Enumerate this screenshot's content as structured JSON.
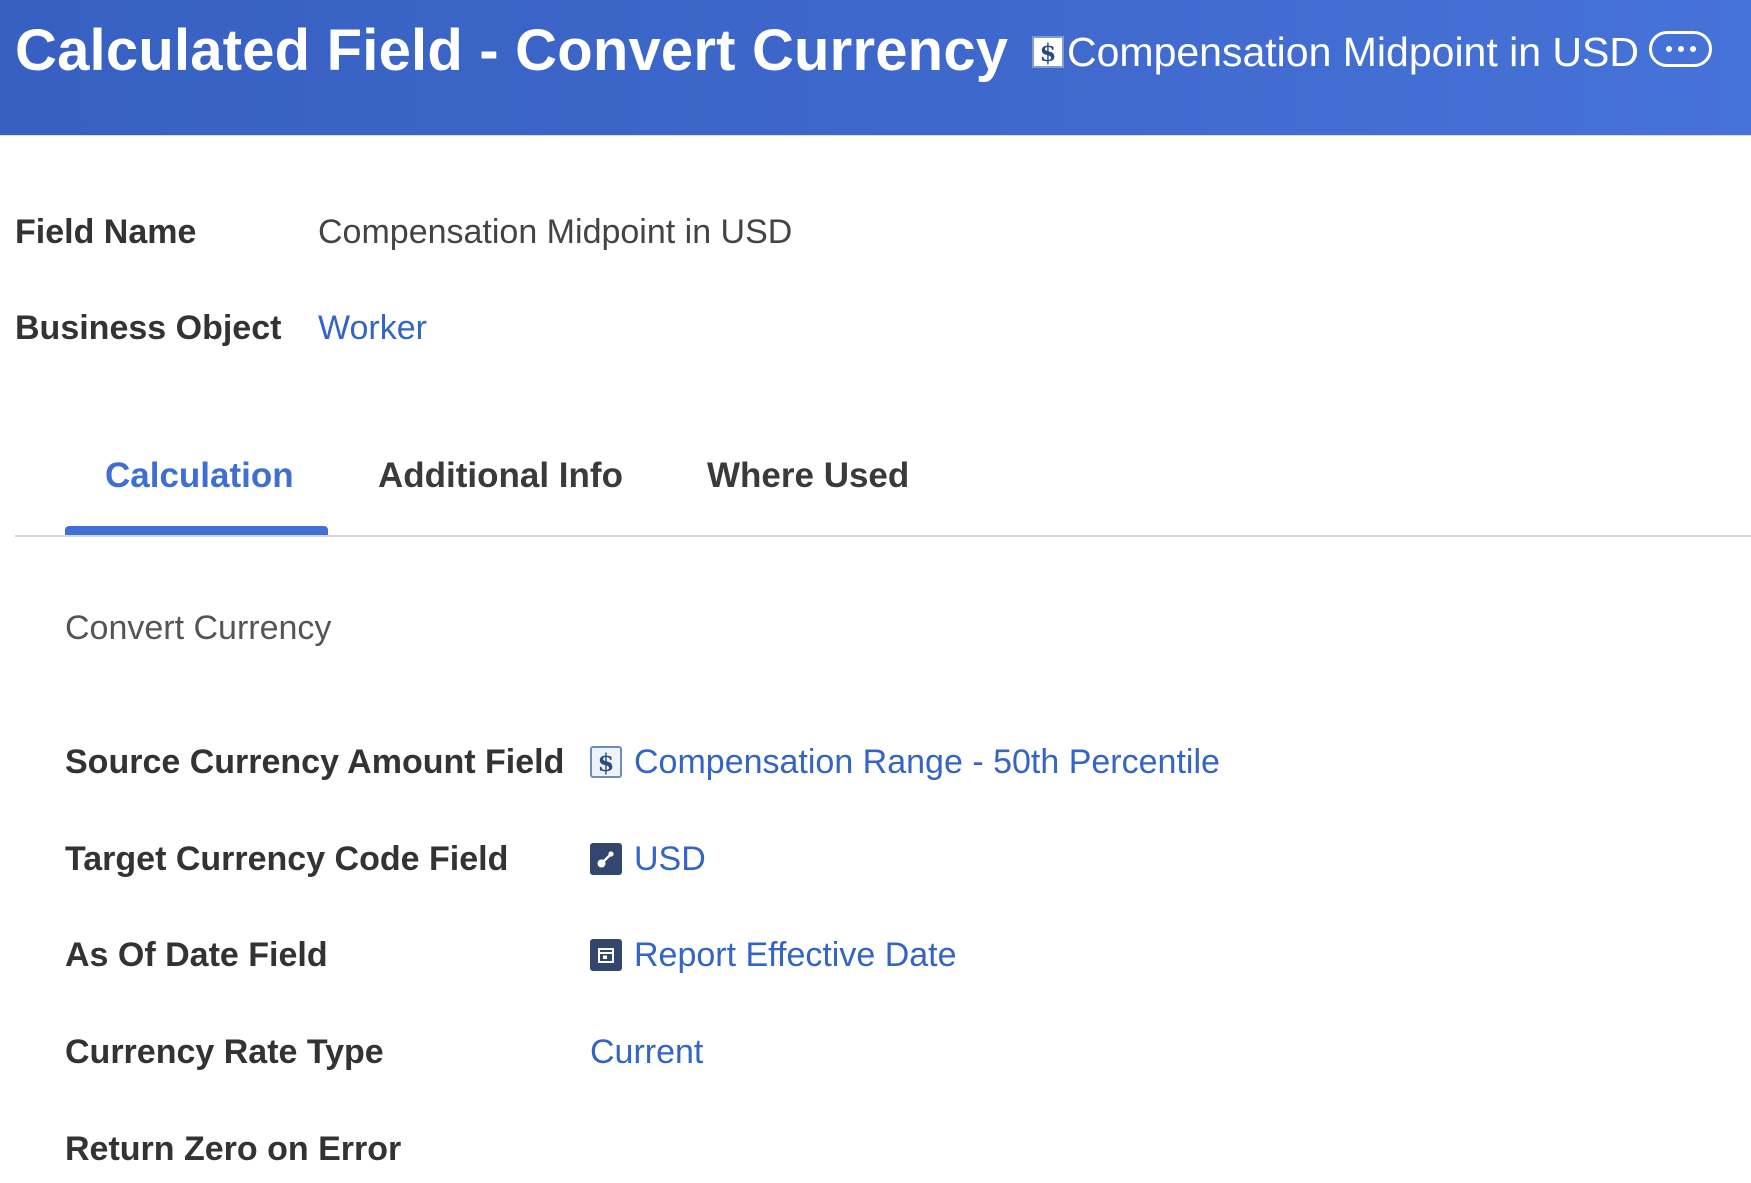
{
  "header": {
    "title": "Calculated Field - Convert Currency",
    "subtitle": "Compensation Midpoint in USD",
    "subtitle_icon": "currency-icon",
    "more_icon": "more-dots-icon"
  },
  "info": {
    "field_name_label": "Field Name",
    "field_name_value": "Compensation Midpoint in USD",
    "business_object_label": "Business Object",
    "business_object_value": "Worker"
  },
  "tabs": [
    {
      "label": "Calculation",
      "active": true
    },
    {
      "label": "Additional Info",
      "active": false
    },
    {
      "label": "Where Used",
      "active": false
    }
  ],
  "calculation": {
    "section_title": "Convert Currency",
    "fields": [
      {
        "label": "Source Currency Amount Field",
        "value": "Compensation Range - 50th Percentile",
        "icon": "currency-icon"
      },
      {
        "label": "Target Currency Code Field",
        "value": "USD",
        "icon": "link-instance-icon"
      },
      {
        "label": "As Of Date Field",
        "value": "Report Effective Date",
        "icon": "calendar-icon"
      },
      {
        "label": "Currency Rate Type",
        "value": "Current",
        "icon": ""
      },
      {
        "label": "Return Zero on Error",
        "value": "",
        "icon": ""
      }
    ]
  },
  "colors": {
    "header_bg": "#3f68cc",
    "link": "#3464c4",
    "active_tab": "#3f6fd1"
  }
}
